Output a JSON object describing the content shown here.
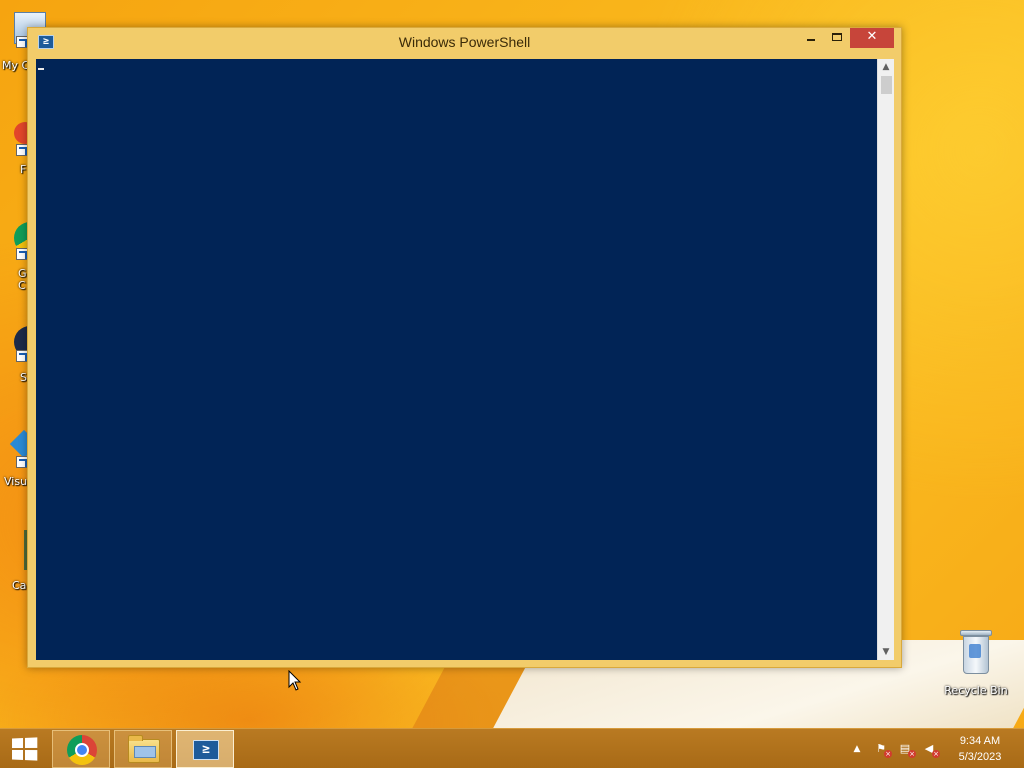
{
  "window": {
    "title": "Windows PowerShell",
    "app_icon_glyph": "≥",
    "close_glyph": "✕",
    "console_background": "#012456"
  },
  "scrollbar": {
    "up_glyph": "▲",
    "down_glyph": "▼",
    "position": 0
  },
  "desktop": {
    "icons": [
      {
        "label": "My C",
        "icon": "computer-icon"
      },
      {
        "label": "F",
        "icon": "shortcut-icon"
      },
      {
        "label": "G\nC",
        "icon": "chrome-icon"
      },
      {
        "label": "S",
        "icon": "shortcut-icon"
      },
      {
        "label": "Visu",
        "icon": "visual-studio-code-icon"
      },
      {
        "label": "Ca",
        "icon": "shortcut-icon"
      }
    ],
    "recycle_bin": {
      "label": "Recycle Bin",
      "icon": "recycle-bin-icon"
    }
  },
  "taskbar": {
    "apps": [
      {
        "name": "Google Chrome",
        "icon": "chrome-icon",
        "active": false
      },
      {
        "name": "File Explorer",
        "icon": "folder-icon",
        "active": false
      },
      {
        "name": "Windows PowerShell",
        "icon": "powershell-icon",
        "active": true
      }
    ],
    "tray": {
      "chevron_glyph": "▲",
      "flag_glyph": "⚑",
      "network_glyph": "▤",
      "volume_glyph": "◀",
      "badge_glyph": "×"
    },
    "clock": {
      "time": "9:34 AM",
      "date": "5/3/2023"
    }
  },
  "colors": {
    "window_frame": "#f2cc6a",
    "close_button": "#c7453a",
    "taskbar": "#a86a16",
    "desktop_accent": "#fbbf22"
  }
}
